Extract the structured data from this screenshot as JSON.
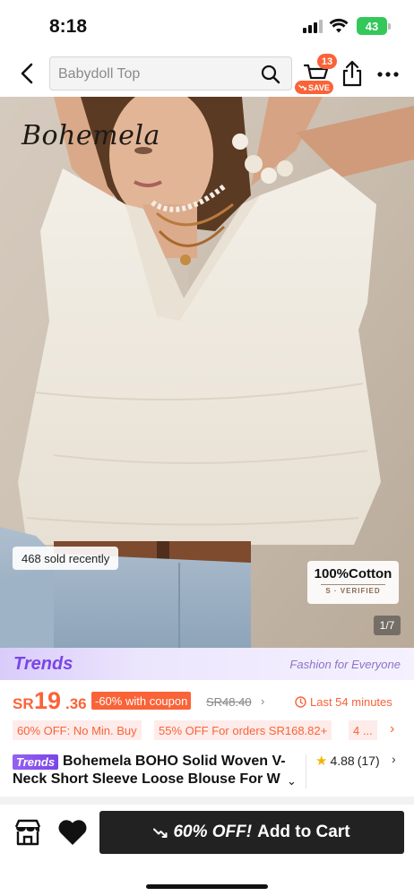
{
  "status_bar": {
    "time": "8:18",
    "battery": "43"
  },
  "header": {
    "search_placeholder": "Babydoll Top",
    "cart_count": "13",
    "save_label": "SAVE"
  },
  "product_image": {
    "brand_logo": "Bohemela",
    "sold_text": "468 sold recently",
    "cotton_title": "100%Cotton",
    "cotton_verified": "S · VERIFIED",
    "page_indicator": "1/7"
  },
  "trends_banner": {
    "logo": "Trends",
    "tagline": "Fashion for Everyone"
  },
  "price": {
    "currency": "SR",
    "main": "19",
    "decimal": ".36",
    "discount_label": "-60% with coupon",
    "original": "SR48.40",
    "timer": "Last 54 minutes"
  },
  "promos": [
    {
      "label": "60% OFF: No Min. Buy"
    },
    {
      "label": "55% OFF For orders SR168.82+"
    },
    {
      "label": "4 ..."
    }
  ],
  "product": {
    "trends_tag": "Trends",
    "title": "Bohemela BOHO Solid Woven V-Neck Short Sleeve Loose Blouse For W",
    "rating": "4.88",
    "review_count": "(17)"
  },
  "bottom_bar": {
    "cta_discount": "60% OFF!",
    "cta_label": "Add to Cart"
  },
  "colors": {
    "accent_orange": "#fa6338",
    "trends_purple": "#7b45e6",
    "cta_black": "#222222"
  }
}
